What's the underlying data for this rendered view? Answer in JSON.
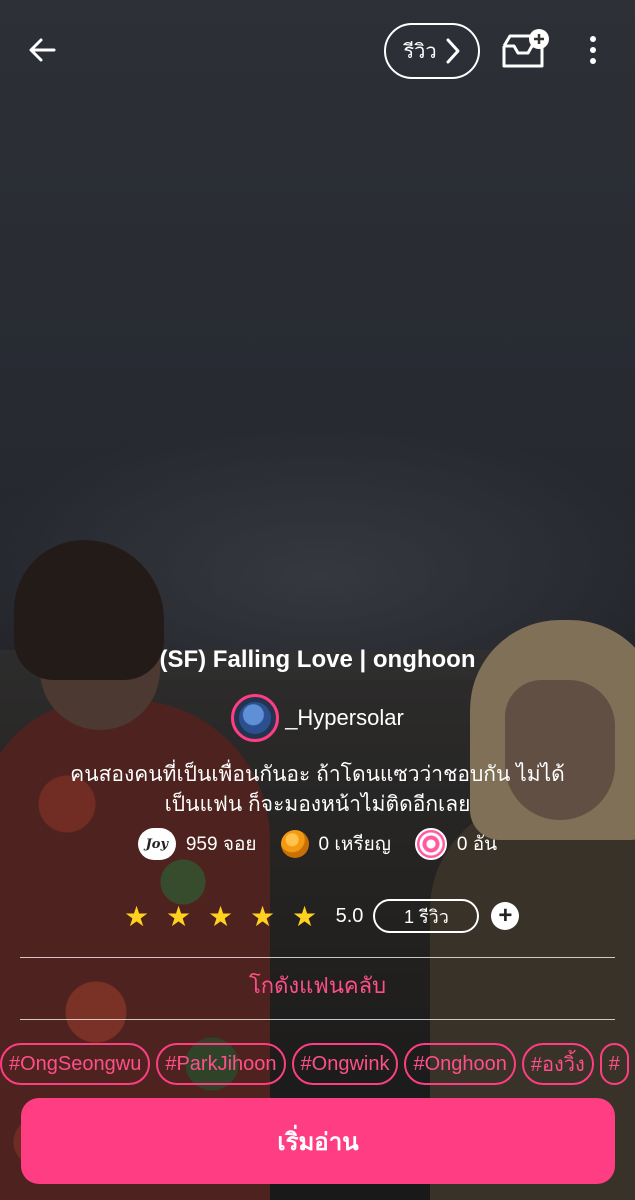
{
  "header": {
    "review_label": "รีวิว"
  },
  "novel": {
    "title": "(SF) Falling Love | onghoon",
    "author": "_Hypersolar",
    "synopsis_line1": "คนสองคนที่เป็นเพื่อนกันอะ ถ้าโดนแซวว่าชอบกัน ไม่ได้",
    "synopsis_line2": "เป็นแฟน ก็จะมองหน้าไม่ติดอีกเลย"
  },
  "stats": {
    "joy_icon_text": "Joy",
    "joy": "959 จอย",
    "coins": "0 เหรียญ",
    "candies": "0 อัน"
  },
  "rating": {
    "stars_filled": 5,
    "value": "5.0",
    "review_count": "1 รีวิว"
  },
  "fanclub_label": "โกดังแฟนคลับ",
  "tags": [
    "#OngSeongwu",
    "#ParkJihoon",
    "#Ongwink",
    "#Onghoon",
    "#องวิ้ง",
    "#"
  ],
  "start_button_label": "เริ่มอ่าน",
  "colors": {
    "accent": "#ff3d83",
    "accent_text": "#ff4f8b",
    "star": "#ffd21f"
  },
  "icons": [
    "back-arrow-icon",
    "chevron-right-icon",
    "library-add-icon",
    "more-vertical-icon",
    "joy-icon",
    "coin-icon",
    "candy-icon",
    "star-icon",
    "plus-icon"
  ]
}
